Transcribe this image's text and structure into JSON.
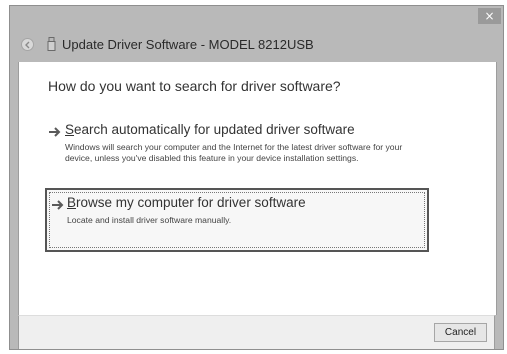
{
  "window": {
    "title": "Update Driver Software - MODEL 8212USB",
    "close_glyph": "×"
  },
  "main": {
    "question": "How do you want to search for driver software?",
    "options": [
      {
        "title_access_key": "S",
        "title_rest": "earch automatically for updated driver software",
        "description": "Windows will search your computer and the Internet for the latest driver software for your device, unless you've disabled this feature in your device installation settings.",
        "icon": "arrow-right-icon"
      },
      {
        "title_access_key": "B",
        "title_rest": "rowse my computer for driver software",
        "description": "Locate and install driver software manually.",
        "icon": "arrow-right-icon",
        "focused": true
      }
    ]
  },
  "footer": {
    "cancel_label": "Cancel"
  },
  "colors": {
    "titlebar": "#b9b9b9",
    "content_bg": "#ffffff",
    "footer_bg": "#efefef",
    "focus_border": "#555555"
  }
}
